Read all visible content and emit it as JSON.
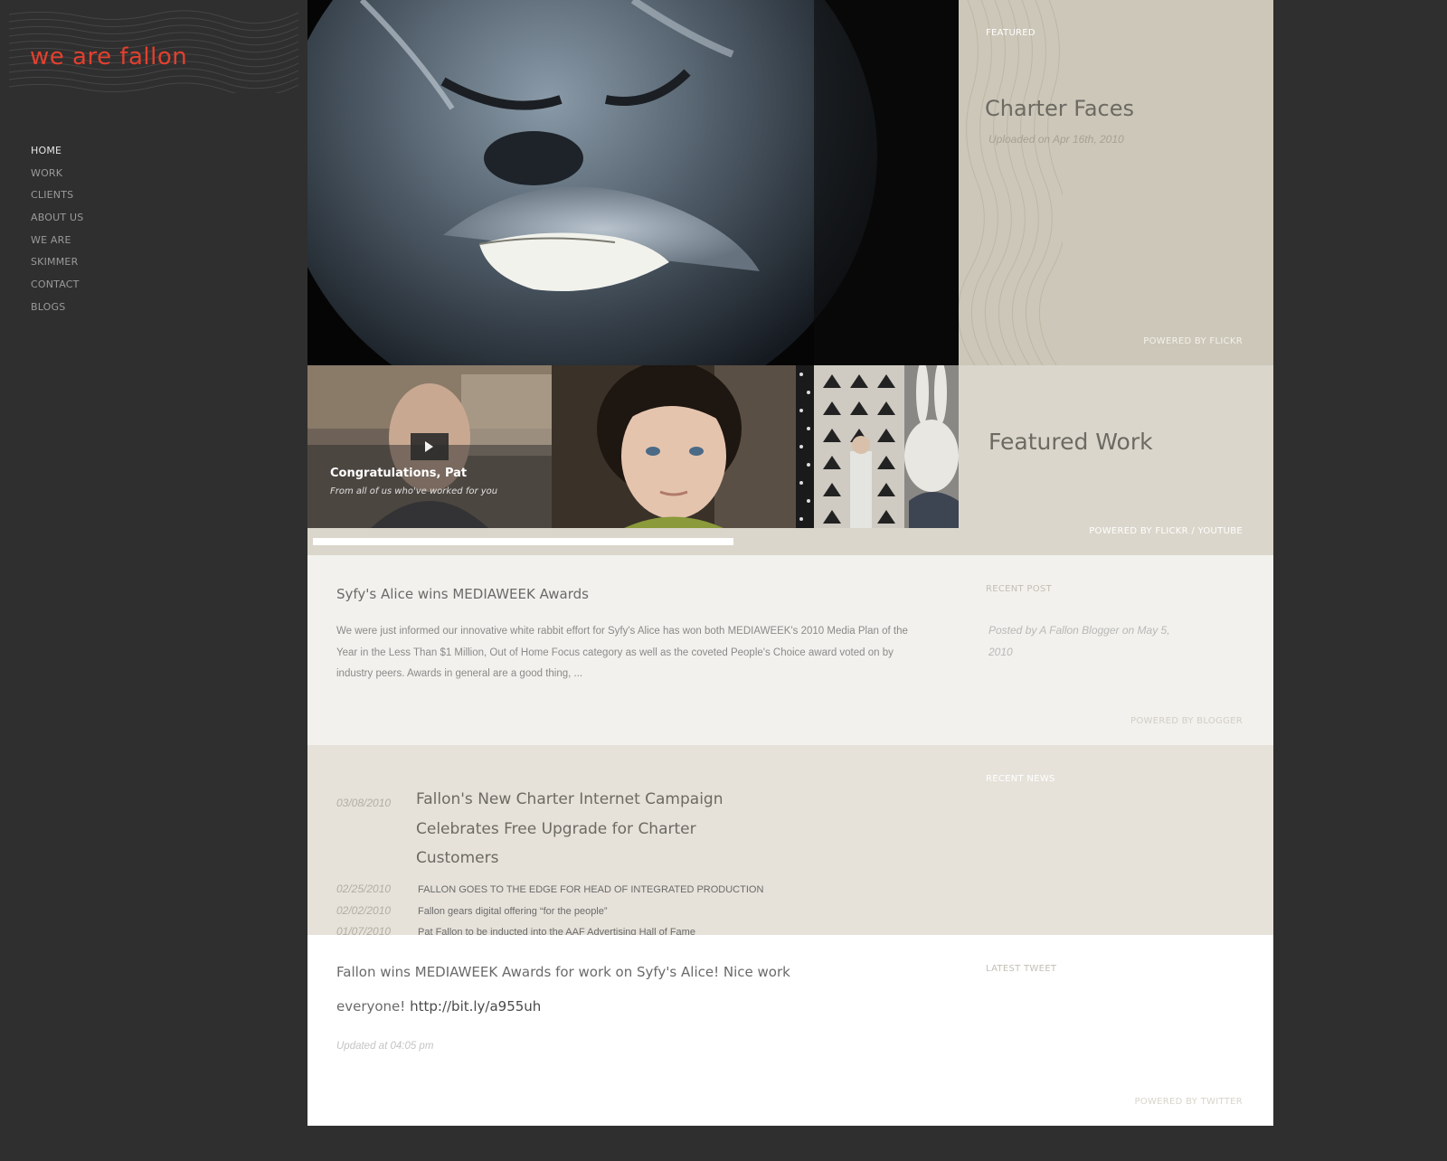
{
  "brand": {
    "logo_text": "we are fallon",
    "accent_color": "#e2402e"
  },
  "nav": {
    "items": [
      {
        "label": "HOME"
      },
      {
        "label": "WORK"
      },
      {
        "label": "CLIENTS"
      },
      {
        "label": "ABOUT US"
      },
      {
        "label": "WE ARE"
      },
      {
        "label": "SKIMMER"
      },
      {
        "label": "CONTACT"
      },
      {
        "label": "BLOGS"
      }
    ]
  },
  "featured": {
    "label": "FEATURED",
    "title": "Charter Faces",
    "uploaded": "Uploaded on Apr 16th, 2010",
    "powered": "POWERED BY FLICKR"
  },
  "featured_work": {
    "title": "Featured Work",
    "powered": "POWERED BY FLICKR / YOUTUBE",
    "thumbs": [
      {
        "title": "Congratulations, Pat",
        "subtitle": "From all of us who've worked for you"
      }
    ]
  },
  "blog": {
    "label": "RECENT POST",
    "title": "Syfy's Alice wins MEDIAWEEK Awards",
    "excerpt_lines": [
      "We were just informed our innovative white rabbit effort for Syfy's Alice has won both MEDIAWEEK's 2010 Media Plan of the",
      "Year in the Less Than $1 Million, Out of Home Focus category as well as the coveted People's Choice award voted on by",
      "industry peers. Awards in general are a good thing, ..."
    ],
    "meta_lines": [
      "Posted by A Fallon Blogger on May 5,",
      "2010"
    ],
    "powered": "POWERED BY BLOGGER"
  },
  "news": {
    "label": "RECENT NEWS",
    "lead": {
      "date": "03/08/2010",
      "title_lines": [
        "Fallon's New Charter Internet Campaign",
        "Celebrates Free Upgrade for Charter",
        "Customers"
      ]
    },
    "items": [
      {
        "date": "02/25/2010",
        "title": "FALLON GOES TO THE EDGE FOR HEAD OF INTEGRATED PRODUCTION"
      },
      {
        "date": "02/02/2010",
        "title": "Fallon gears digital offering “for the people”"
      },
      {
        "date": "01/07/2010",
        "title": "Pat Fallon to be inducted into the AAF Advertising Hall of Fame"
      }
    ]
  },
  "tweet": {
    "label": "LATEST TWEET",
    "text_line1": "Fallon wins MEDIAWEEK Awards for work on Syfy's Alice! Nice work",
    "text_line2": "everyone!",
    "link": "http://bit.ly/a955uh",
    "updated": "Updated at 04:05 pm",
    "powered": "POWERED BY TWITTER"
  }
}
